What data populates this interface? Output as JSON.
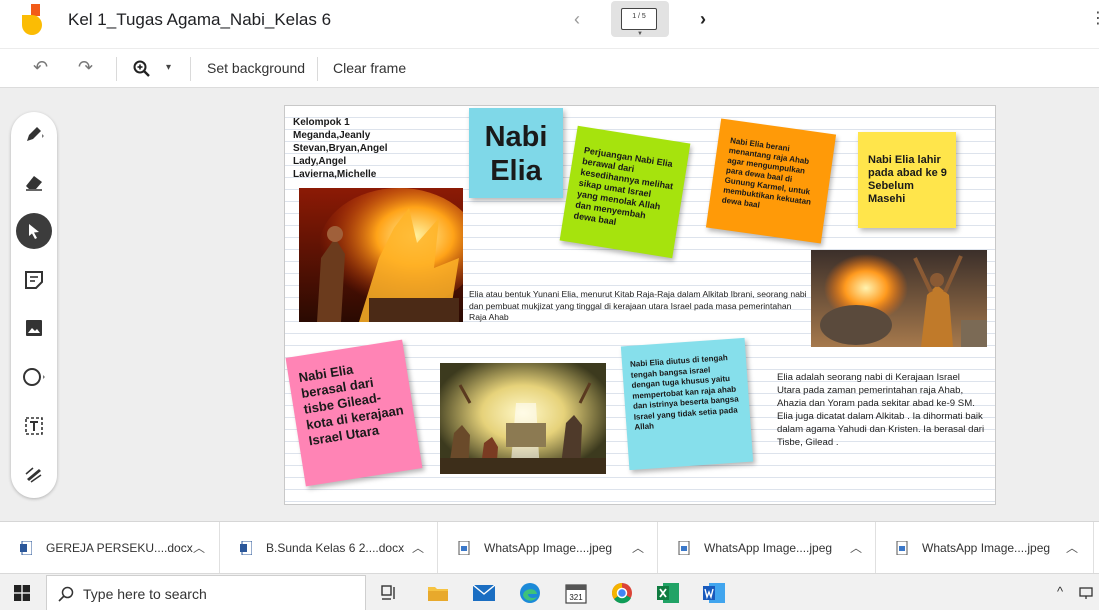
{
  "header": {
    "doc_title": "Kel 1_Tugas Agama_Nabi_Kelas 6",
    "frame_counter": "1 / 5",
    "prev_glyph": "‹",
    "next_glyph": "›",
    "more_glyph": "⋮"
  },
  "toolbar": {
    "undo_glyph": "↶",
    "redo_glyph": "↷",
    "zoom_caret": "▾",
    "set_background": "Set background",
    "clear_frame": "Clear frame"
  },
  "board": {
    "group_lines": [
      "Kelompok 1",
      "Meganda,Jeanly",
      "Stevan,Bryan,Angel",
      "Lady,Angel",
      "Lavierna,Michelle"
    ],
    "title_note": {
      "line1": "Nabi",
      "line2": "Elia",
      "color": "#7fd8e8"
    },
    "green_note": {
      "text": "Perjuangan Nabi Elia berawal dari kesedihannya melihat sikap umat Israel yang menolak Allah dan menyembah dewa baal",
      "color": "#a6e30d"
    },
    "orange_note": {
      "text": "Nabi Elia berani menantang raja Ahab agar mengumpulkan para dewa baal di Gunung Karmel, untuk membuktikan kekuatan dewa baal",
      "color": "#ff9a08"
    },
    "yellow_note": {
      "text": "Nabi Elia lahir pada abad ke 9 Sebelum Masehi",
      "color": "#ffe54b"
    },
    "pink_note": {
      "text": "Nabi Elia berasal dari tisbe Gilead-kota di kerajaan Israel Utara",
      "color": "#ff84b5"
    },
    "cyan_note": {
      "text": "Nabi Elia diutus di tengah tengah bangsa israel dengan tuga khusus yaitu mempertobat kan raja ahab dan istrinya beserta bangsa Israel yang tidak setia pada Allah",
      "color": "#86dfeb"
    },
    "paragraph1": "Elia atau bentuk Yunani Elia, menurut Kitab Raja-Raja dalam Alkitab Ibrani, seorang nabi dan pembuat mukjizat yang tinggal di kerajaan utara Israel pada masa pemerintahan Raja Ahab",
    "paragraph2": " Elia adalah seorang nabi di Kerajaan Israel Utara pada zaman pemerintahan raja Ahab, Ahazia dan Yoram pada sekitar abad ke-9 SM. Elia juga dicatat dalam Alkitab . Ia dihormati baik dalam agama Yahudi dan Kristen. Ia berasal dari Tisbe, Gilead ."
  },
  "downloads": [
    {
      "name": "GEREJA PERSEKU....docx",
      "type": "word"
    },
    {
      "name": "B.Sunda Kelas 6 2....docx",
      "type": "word"
    },
    {
      "name": "WhatsApp Image....jpeg",
      "type": "image"
    },
    {
      "name": "WhatsApp Image....jpeg",
      "type": "image"
    },
    {
      "name": "WhatsApp Image....jpeg",
      "type": "image"
    }
  ],
  "taskbar": {
    "search_placeholder": "Type here to search",
    "calendar_day": "321",
    "tray_caret": "^"
  },
  "colors": {
    "accent_red": "#d93025",
    "jamboard_yellow": "#fbbc04",
    "active_tool": "#3c3c3c"
  }
}
